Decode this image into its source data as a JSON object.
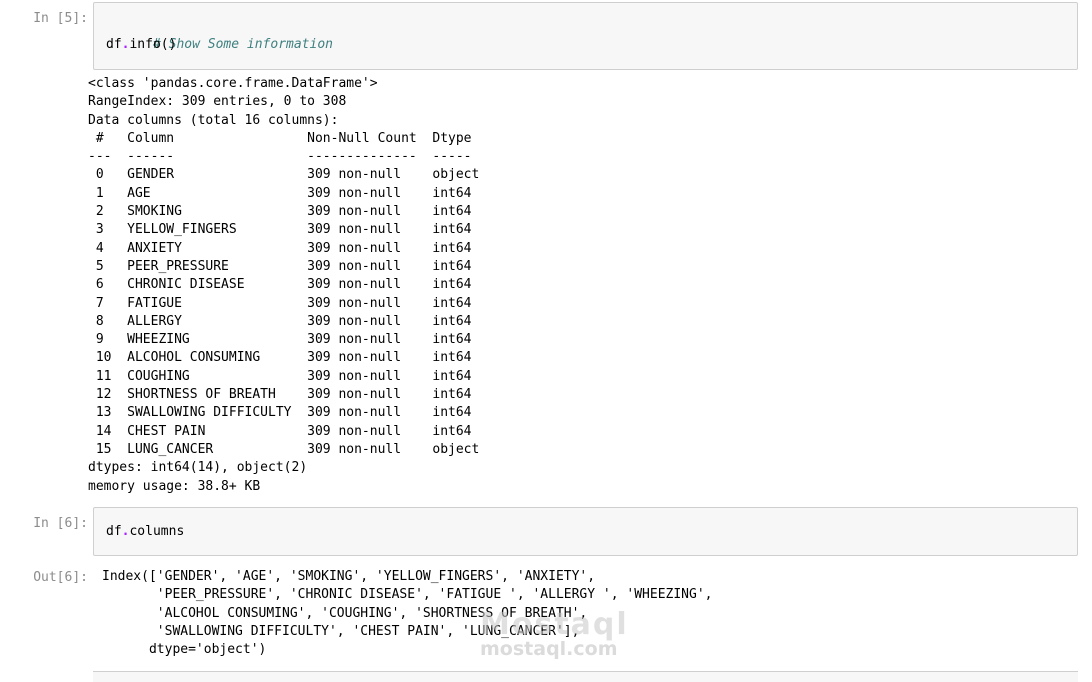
{
  "cells": [
    {
      "prompt": "In [5]:",
      "code_comment": "# Show Some information",
      "code_var": "df",
      "code_dot": ".",
      "code_call": "info",
      "code_parens": "()",
      "output": "<class 'pandas.core.frame.DataFrame'>\nRangeIndex: 309 entries, 0 to 308\nData columns (total 16 columns):\n #   Column                 Non-Null Count  Dtype \n---  ------                 --------------  ----- \n 0   GENDER                 309 non-null    object\n 1   AGE                    309 non-null    int64 \n 2   SMOKING                309 non-null    int64 \n 3   YELLOW_FINGERS         309 non-null    int64 \n 4   ANXIETY                309 non-null    int64 \n 5   PEER_PRESSURE          309 non-null    int64 \n 6   CHRONIC DISEASE        309 non-null    int64 \n 7   FATIGUE                309 non-null    int64 \n 8   ALLERGY                309 non-null    int64 \n 9   WHEEZING               309 non-null    int64 \n 10  ALCOHOL CONSUMING      309 non-null    int64 \n 11  COUGHING               309 non-null    int64 \n 12  SHORTNESS OF BREATH    309 non-null    int64 \n 13  SWALLOWING DIFFICULTY  309 non-null    int64 \n 14  CHEST PAIN             309 non-null    int64 \n 15  LUNG_CANCER            309 non-null    object\ndtypes: int64(14), object(2)\nmemory usage: 38.8+ KB"
    },
    {
      "prompt": "In [6]:",
      "code_var": "df",
      "code_dot": ".",
      "code_call": "columns",
      "out_prompt": "Out[6]:",
      "output": "Index(['GENDER', 'AGE', 'SMOKING', 'YELLOW_FINGERS', 'ANXIETY',\n       'PEER_PRESSURE', 'CHRONIC DISEASE', 'FATIGUE ', 'ALLERGY ', 'WHEEZING',\n       'ALCOHOL CONSUMING', 'COUGHING', 'SHORTNESS OF BREATH',\n       'SWALLOWING DIFFICULTY', 'CHEST PAIN', 'LUNG_CANCER'],\n      dtype='object')"
    }
  ],
  "watermark": {
    "logo": "Mostaql",
    "text": "mostaql.com"
  },
  "colors": {
    "prompt": "#8c8c8c",
    "cell_bg": "#f7f7f7",
    "cell_border": "#cfcfcf",
    "comment": "#408080",
    "operator": "#aa22ff"
  }
}
